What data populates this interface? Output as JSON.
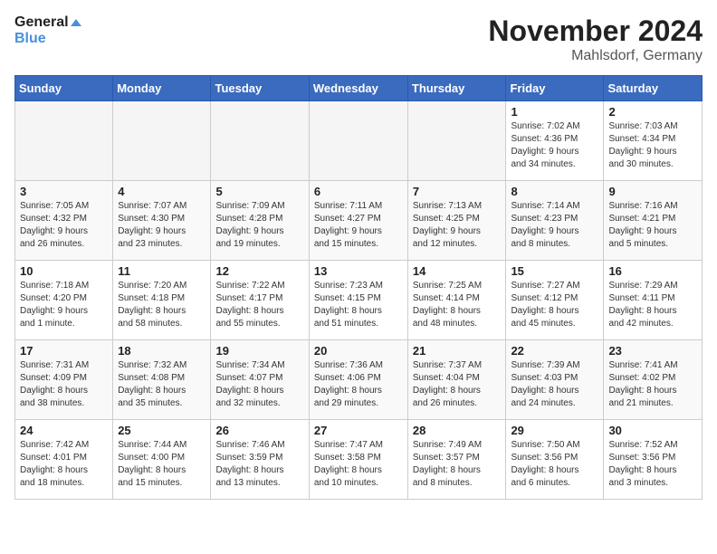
{
  "header": {
    "logo_line1": "General",
    "logo_line2": "Blue",
    "month_title": "November 2024",
    "location": "Mahlsdorf, Germany"
  },
  "days_of_week": [
    "Sunday",
    "Monday",
    "Tuesday",
    "Wednesday",
    "Thursday",
    "Friday",
    "Saturday"
  ],
  "weeks": [
    [
      {
        "day": "",
        "info": ""
      },
      {
        "day": "",
        "info": ""
      },
      {
        "day": "",
        "info": ""
      },
      {
        "day": "",
        "info": ""
      },
      {
        "day": "",
        "info": ""
      },
      {
        "day": "1",
        "info": "Sunrise: 7:02 AM\nSunset: 4:36 PM\nDaylight: 9 hours\nand 34 minutes."
      },
      {
        "day": "2",
        "info": "Sunrise: 7:03 AM\nSunset: 4:34 PM\nDaylight: 9 hours\nand 30 minutes."
      }
    ],
    [
      {
        "day": "3",
        "info": "Sunrise: 7:05 AM\nSunset: 4:32 PM\nDaylight: 9 hours\nand 26 minutes."
      },
      {
        "day": "4",
        "info": "Sunrise: 7:07 AM\nSunset: 4:30 PM\nDaylight: 9 hours\nand 23 minutes."
      },
      {
        "day": "5",
        "info": "Sunrise: 7:09 AM\nSunset: 4:28 PM\nDaylight: 9 hours\nand 19 minutes."
      },
      {
        "day": "6",
        "info": "Sunrise: 7:11 AM\nSunset: 4:27 PM\nDaylight: 9 hours\nand 15 minutes."
      },
      {
        "day": "7",
        "info": "Sunrise: 7:13 AM\nSunset: 4:25 PM\nDaylight: 9 hours\nand 12 minutes."
      },
      {
        "day": "8",
        "info": "Sunrise: 7:14 AM\nSunset: 4:23 PM\nDaylight: 9 hours\nand 8 minutes."
      },
      {
        "day": "9",
        "info": "Sunrise: 7:16 AM\nSunset: 4:21 PM\nDaylight: 9 hours\nand 5 minutes."
      }
    ],
    [
      {
        "day": "10",
        "info": "Sunrise: 7:18 AM\nSunset: 4:20 PM\nDaylight: 9 hours\nand 1 minute."
      },
      {
        "day": "11",
        "info": "Sunrise: 7:20 AM\nSunset: 4:18 PM\nDaylight: 8 hours\nand 58 minutes."
      },
      {
        "day": "12",
        "info": "Sunrise: 7:22 AM\nSunset: 4:17 PM\nDaylight: 8 hours\nand 55 minutes."
      },
      {
        "day": "13",
        "info": "Sunrise: 7:23 AM\nSunset: 4:15 PM\nDaylight: 8 hours\nand 51 minutes."
      },
      {
        "day": "14",
        "info": "Sunrise: 7:25 AM\nSunset: 4:14 PM\nDaylight: 8 hours\nand 48 minutes."
      },
      {
        "day": "15",
        "info": "Sunrise: 7:27 AM\nSunset: 4:12 PM\nDaylight: 8 hours\nand 45 minutes."
      },
      {
        "day": "16",
        "info": "Sunrise: 7:29 AM\nSunset: 4:11 PM\nDaylight: 8 hours\nand 42 minutes."
      }
    ],
    [
      {
        "day": "17",
        "info": "Sunrise: 7:31 AM\nSunset: 4:09 PM\nDaylight: 8 hours\nand 38 minutes."
      },
      {
        "day": "18",
        "info": "Sunrise: 7:32 AM\nSunset: 4:08 PM\nDaylight: 8 hours\nand 35 minutes."
      },
      {
        "day": "19",
        "info": "Sunrise: 7:34 AM\nSunset: 4:07 PM\nDaylight: 8 hours\nand 32 minutes."
      },
      {
        "day": "20",
        "info": "Sunrise: 7:36 AM\nSunset: 4:06 PM\nDaylight: 8 hours\nand 29 minutes."
      },
      {
        "day": "21",
        "info": "Sunrise: 7:37 AM\nSunset: 4:04 PM\nDaylight: 8 hours\nand 26 minutes."
      },
      {
        "day": "22",
        "info": "Sunrise: 7:39 AM\nSunset: 4:03 PM\nDaylight: 8 hours\nand 24 minutes."
      },
      {
        "day": "23",
        "info": "Sunrise: 7:41 AM\nSunset: 4:02 PM\nDaylight: 8 hours\nand 21 minutes."
      }
    ],
    [
      {
        "day": "24",
        "info": "Sunrise: 7:42 AM\nSunset: 4:01 PM\nDaylight: 8 hours\nand 18 minutes."
      },
      {
        "day": "25",
        "info": "Sunrise: 7:44 AM\nSunset: 4:00 PM\nDaylight: 8 hours\nand 15 minutes."
      },
      {
        "day": "26",
        "info": "Sunrise: 7:46 AM\nSunset: 3:59 PM\nDaylight: 8 hours\nand 13 minutes."
      },
      {
        "day": "27",
        "info": "Sunrise: 7:47 AM\nSunset: 3:58 PM\nDaylight: 8 hours\nand 10 minutes."
      },
      {
        "day": "28",
        "info": "Sunrise: 7:49 AM\nSunset: 3:57 PM\nDaylight: 8 hours\nand 8 minutes."
      },
      {
        "day": "29",
        "info": "Sunrise: 7:50 AM\nSunset: 3:56 PM\nDaylight: 8 hours\nand 6 minutes."
      },
      {
        "day": "30",
        "info": "Sunrise: 7:52 AM\nSunset: 3:56 PM\nDaylight: 8 hours\nand 3 minutes."
      }
    ]
  ]
}
